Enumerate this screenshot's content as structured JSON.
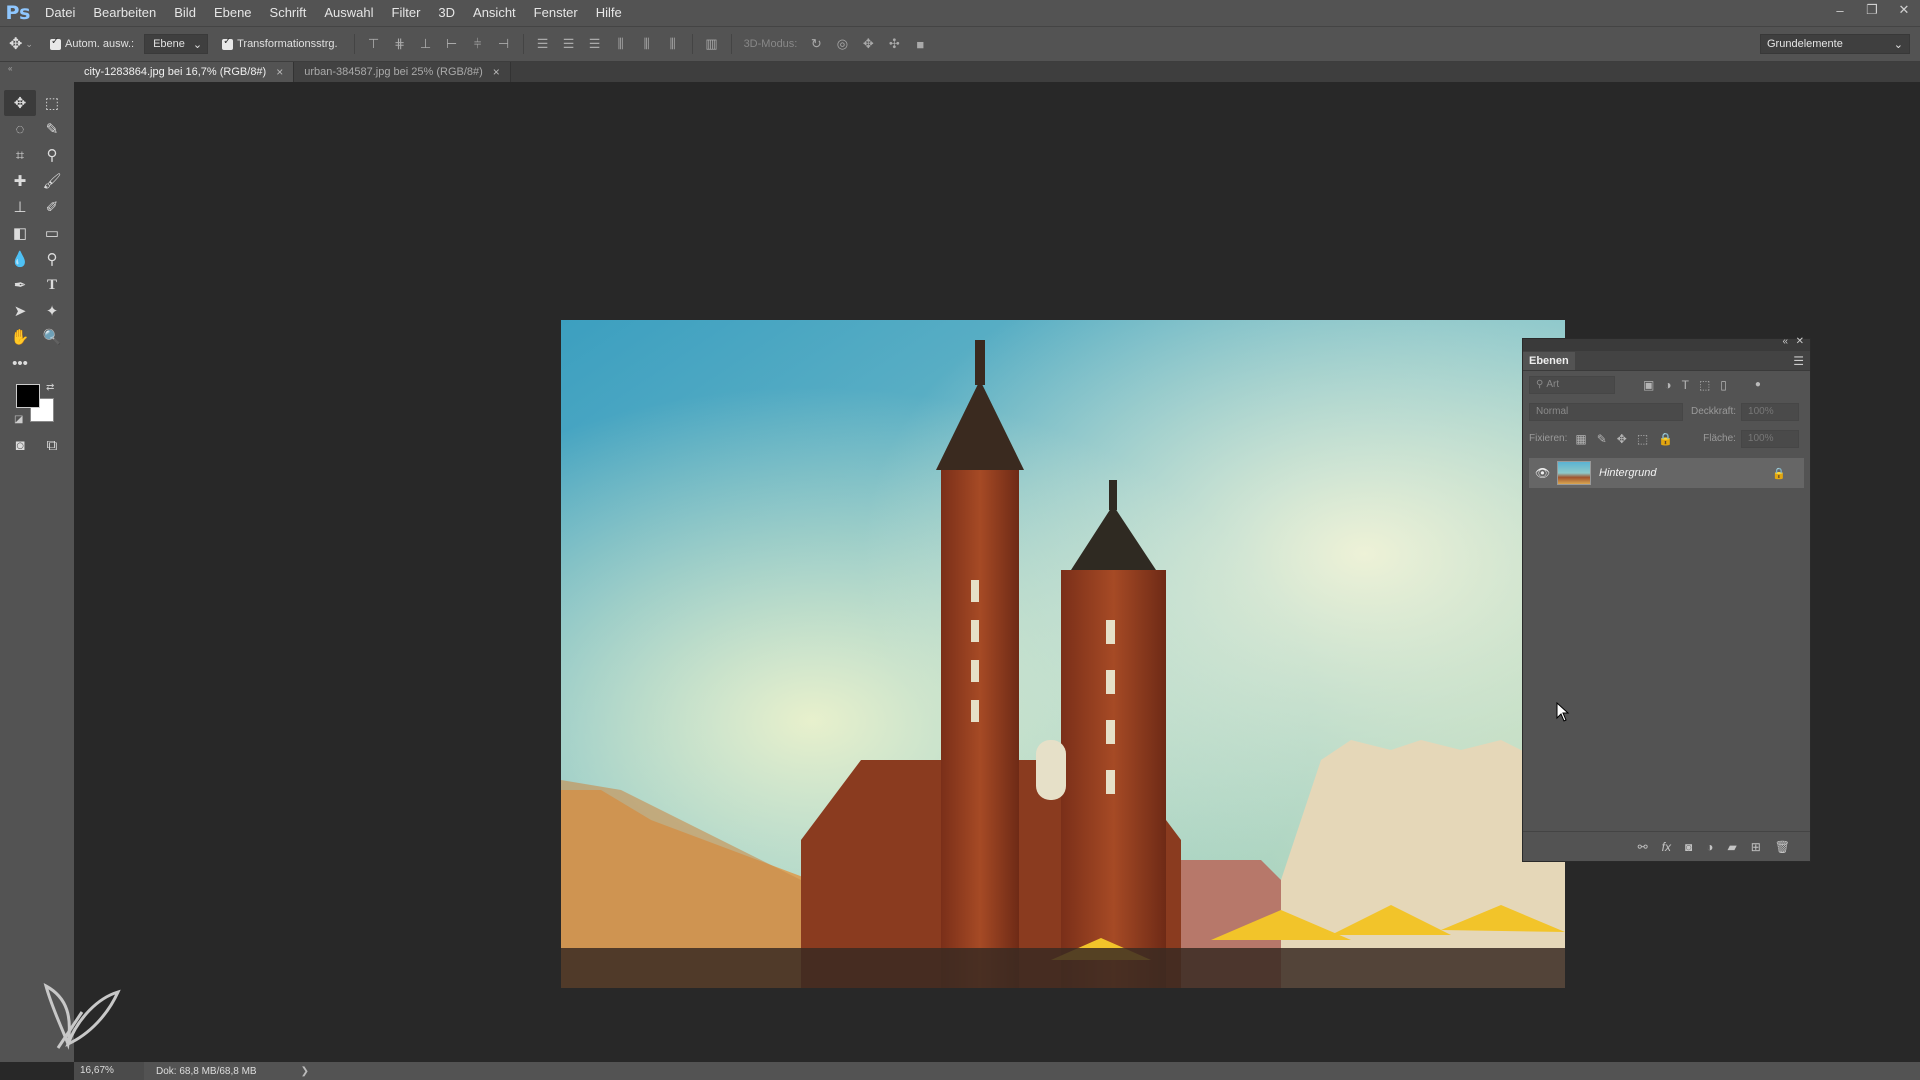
{
  "app": {
    "logo": "Ps"
  },
  "menu": [
    "Datei",
    "Bearbeiten",
    "Bild",
    "Ebene",
    "Schrift",
    "Auswahl",
    "Filter",
    "3D",
    "Ansicht",
    "Fenster",
    "Hilfe"
  ],
  "options": {
    "auto_select_label": "Autom. ausw.:",
    "auto_select_target": "Ebene",
    "transform_label": "Transformationsstrg.",
    "mode3d_label": "3D-Modus:",
    "workspace": "Grundelemente"
  },
  "tabs": [
    {
      "label": "city-1283864.jpg bei 16,7% (RGB/8#)",
      "close": "×"
    },
    {
      "label": "urban-384587.jpg bei 25% (RGB/8#)",
      "close": "×"
    }
  ],
  "layers_panel": {
    "title": "Ebenen",
    "filter_placeholder": "Art",
    "blend_mode": "Normal",
    "opacity_label": "Deckkraft:",
    "opacity_value": "100%",
    "lock_label": "Fixieren:",
    "fill_label": "Fläche:",
    "fill_value": "100%",
    "layers": [
      {
        "name": "Hintergrund",
        "visible": true,
        "locked": true
      }
    ]
  },
  "status": {
    "zoom": "16,67%",
    "doc_info": "Dok: 68,8 MB/68,8 MB",
    "arrow": "❯"
  },
  "colors": {
    "foreground": "#000000",
    "background": "#ffffff"
  }
}
